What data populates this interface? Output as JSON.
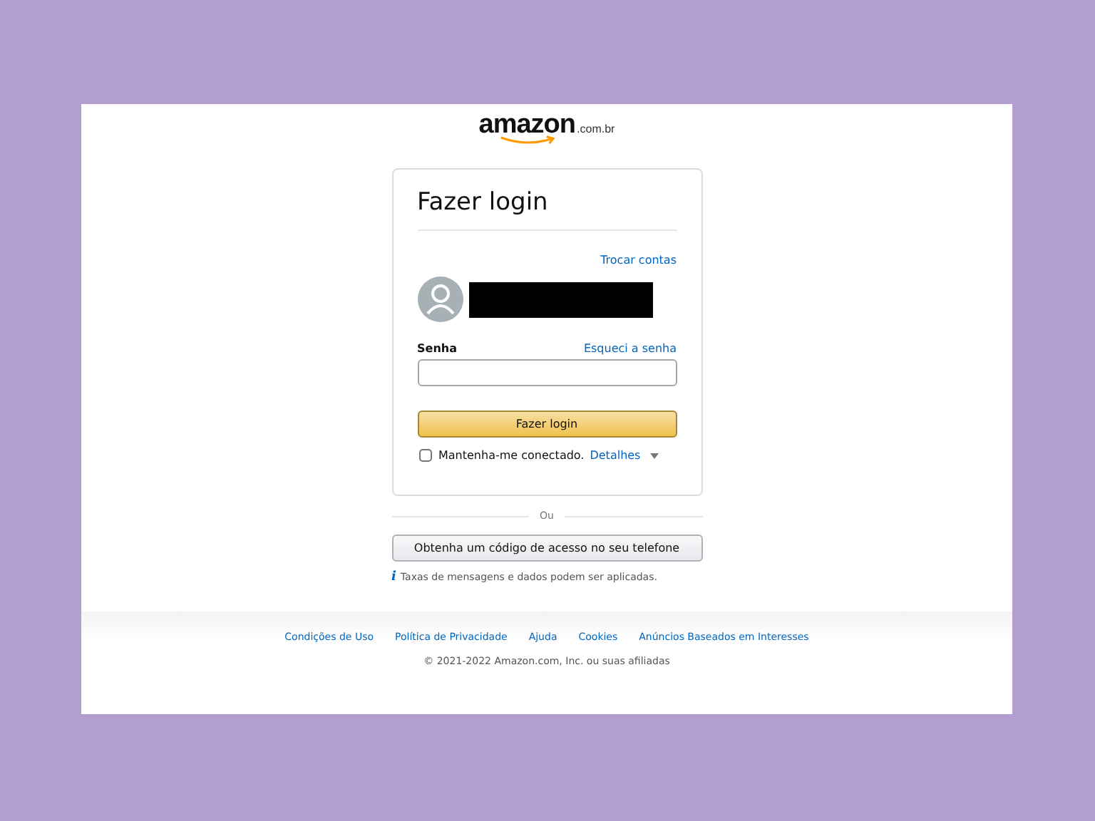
{
  "logo": {
    "wordmark": "amazon",
    "domain": ".com.br"
  },
  "card": {
    "title": "Fazer login",
    "switch_link": "Trocar contas",
    "password_label": "Senha",
    "forgot_link": "Esqueci a senha",
    "submit": "Fazer login",
    "remember": {
      "label": "Mantenha-me conectado.",
      "checked": false
    },
    "details_link": "Detalhes"
  },
  "divider_text": "Ou",
  "otp_button": "Obtenha um código de acesso no seu telefone",
  "notice": {
    "icon": "i",
    "text": "Taxas de mensagens e dados podem ser aplicadas."
  },
  "footer": {
    "links": [
      "Condições de Uso",
      "Política de Privacidade",
      "Ajuda",
      "Cookies",
      "Anúncios Baseados em Interesses"
    ],
    "copyright": "© 2021-2022 Amazon.com, Inc. ou suas afiliadas"
  }
}
